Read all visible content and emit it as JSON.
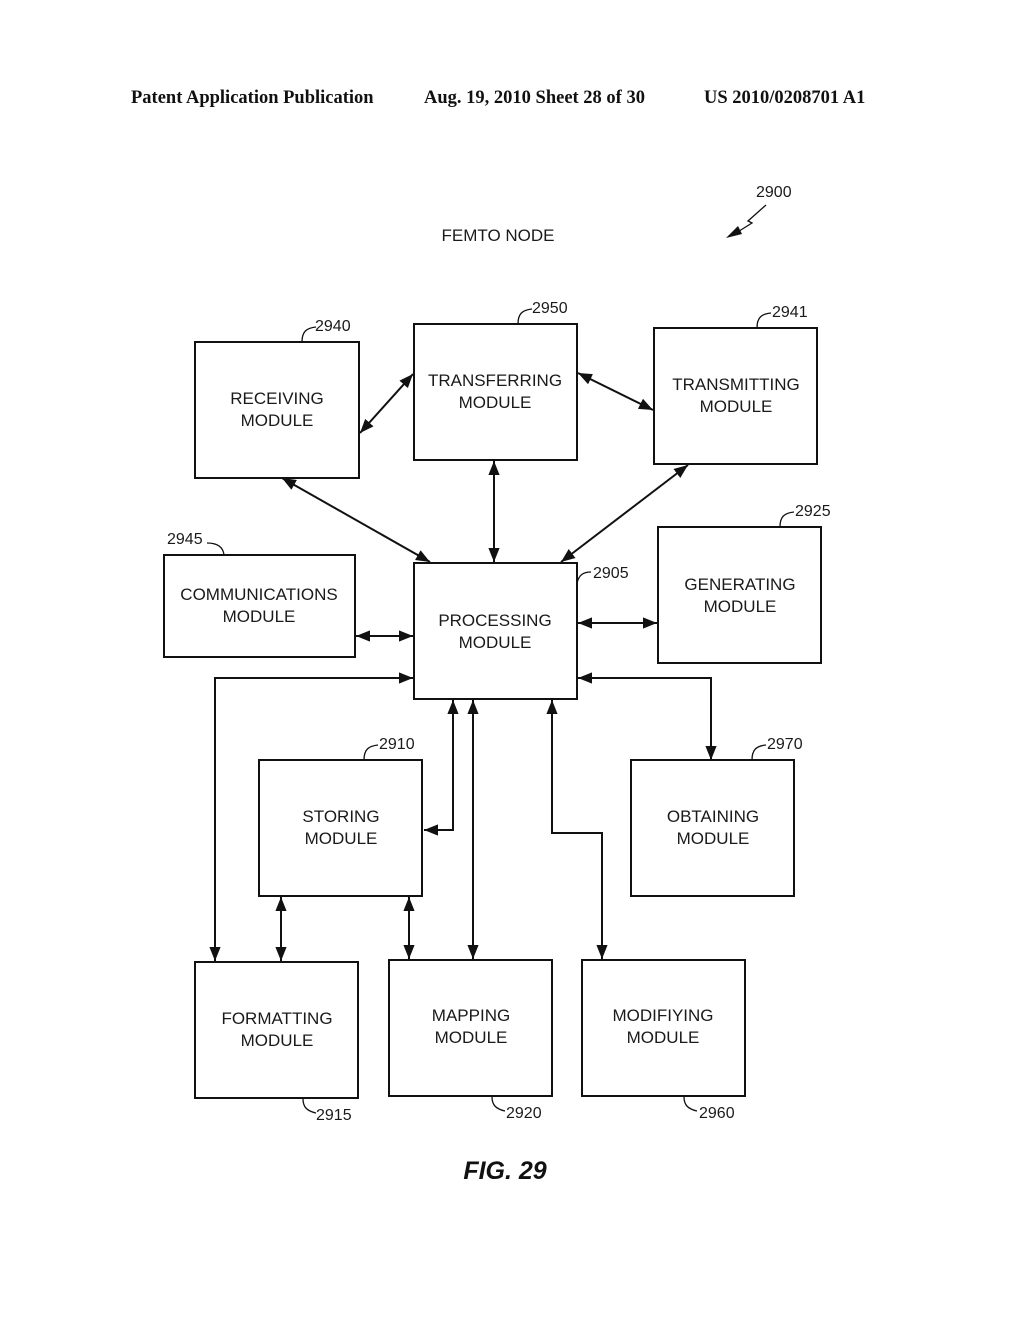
{
  "header": {
    "publication": "Patent Application Publication",
    "date_sheet": "Aug. 19, 2010  Sheet 28 of 30",
    "number": "US 2010/0208701 A1"
  },
  "diagram": {
    "title": "FEMTO NODE",
    "figure_ref": "2900",
    "caption": "FIG. 29",
    "modules": {
      "receiving": {
        "line1": "RECEIVING",
        "line2": "MODULE",
        "ref": "2940"
      },
      "transferring": {
        "line1": "TRANSFERRING",
        "line2": "MODULE",
        "ref": "2950"
      },
      "transmitting": {
        "line1": "TRANSMITTING",
        "line2": "MODULE",
        "ref": "2941"
      },
      "communications": {
        "line1": "COMMUNICATIONS",
        "line2": "MODULE",
        "ref": "2945"
      },
      "processing": {
        "line1": "PROCESSING",
        "line2": "MODULE",
        "ref": "2905"
      },
      "generating": {
        "line1": "GENERATING",
        "line2": "MODULE",
        "ref": "2925"
      },
      "storing": {
        "line1": "STORING",
        "line2": "MODULE",
        "ref": "2910"
      },
      "obtaining": {
        "line1": "OBTAINING",
        "line2": "MODULE",
        "ref": "2970"
      },
      "formatting": {
        "line1": "FORMATTING",
        "line2": "MODULE",
        "ref": "2915"
      },
      "mapping": {
        "line1": "MAPPING",
        "line2": "MODULE",
        "ref": "2920"
      },
      "modifying": {
        "line1": "MODIFIYING",
        "line2": "MODULE",
        "ref": "2960"
      }
    },
    "connections": [
      {
        "from": "receiving",
        "to": "transferring",
        "direction": "bidirectional"
      },
      {
        "from": "transferring",
        "to": "transmitting",
        "direction": "bidirectional"
      },
      {
        "from": "receiving",
        "to": "processing",
        "direction": "bidirectional"
      },
      {
        "from": "transferring",
        "to": "processing",
        "direction": "bidirectional"
      },
      {
        "from": "transmitting",
        "to": "processing",
        "direction": "bidirectional"
      },
      {
        "from": "communications",
        "to": "processing",
        "direction": "bidirectional"
      },
      {
        "from": "processing",
        "to": "generating",
        "direction": "bidirectional"
      },
      {
        "from": "processing",
        "to": "formatting",
        "direction": "bidirectional"
      },
      {
        "from": "processing",
        "to": "obtaining",
        "direction": "bidirectional"
      },
      {
        "from": "processing",
        "to": "storing",
        "direction": "bidirectional"
      },
      {
        "from": "processing",
        "to": "mapping",
        "direction": "bidirectional"
      },
      {
        "from": "processing",
        "to": "modifying",
        "direction": "bidirectional"
      },
      {
        "from": "storing",
        "to": "formatting",
        "direction": "bidirectional"
      },
      {
        "from": "storing",
        "to": "mapping",
        "direction": "bidirectional"
      }
    ]
  }
}
